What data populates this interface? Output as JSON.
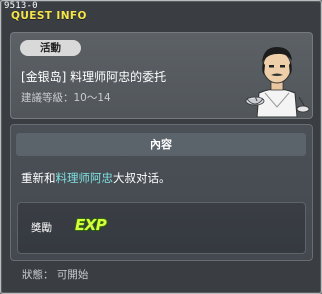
{
  "window": {
    "code": "9513-0",
    "title": "QUEST INFO"
  },
  "quest": {
    "badge": "活動",
    "title": "[金银岛] 料理师阿忠的委托",
    "level": "建議等級：10～14",
    "npc_icon": "chef-npc-icon"
  },
  "content": {
    "header": "內容",
    "desc_prefix": "重新和",
    "desc_npc": "料理师阿忠",
    "desc_suffix": "大叔对话。"
  },
  "reward": {
    "label": "獎勵",
    "exp": "EXP"
  },
  "status": {
    "text": "狀態： 可開始"
  },
  "colors": {
    "title": "#f5e54a",
    "highlight": "#7ee0e0",
    "exp": "#d8ff3a"
  }
}
